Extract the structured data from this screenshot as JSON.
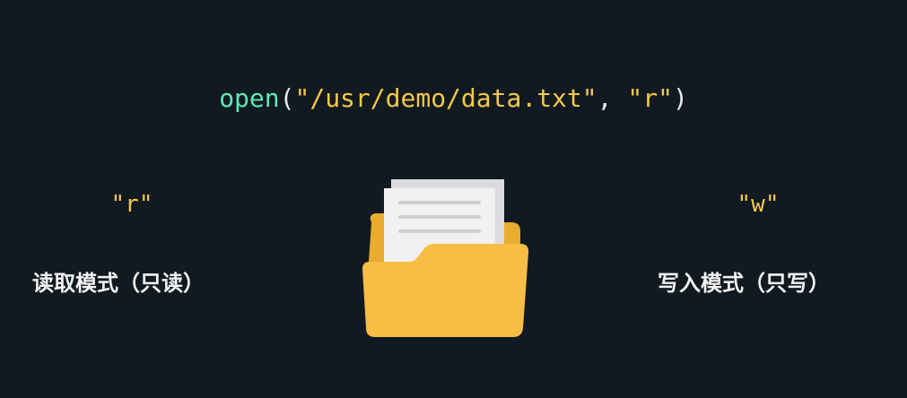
{
  "code": {
    "function": "open",
    "open_paren": "(",
    "path": "\"/usr/demo/data.txt\"",
    "separator": ", ",
    "mode": "\"r\"",
    "close_paren": ")"
  },
  "modes": {
    "read": {
      "code": "\"r\"",
      "label": "读取模式（只读）"
    },
    "write": {
      "code": "\"w\"",
      "label": "写入模式（只写）"
    }
  },
  "icons": {
    "center": "open-folder-with-document-icon"
  },
  "colors": {
    "background": "#121a21",
    "function_name": "#5ee8b5",
    "string": "#f3c94a",
    "punctuation": "#e9e9e9",
    "label": "#f2f2f2",
    "folder": "#f8bd45",
    "folder_back": "#e9ac2e",
    "paper": "#eeeeee"
  }
}
